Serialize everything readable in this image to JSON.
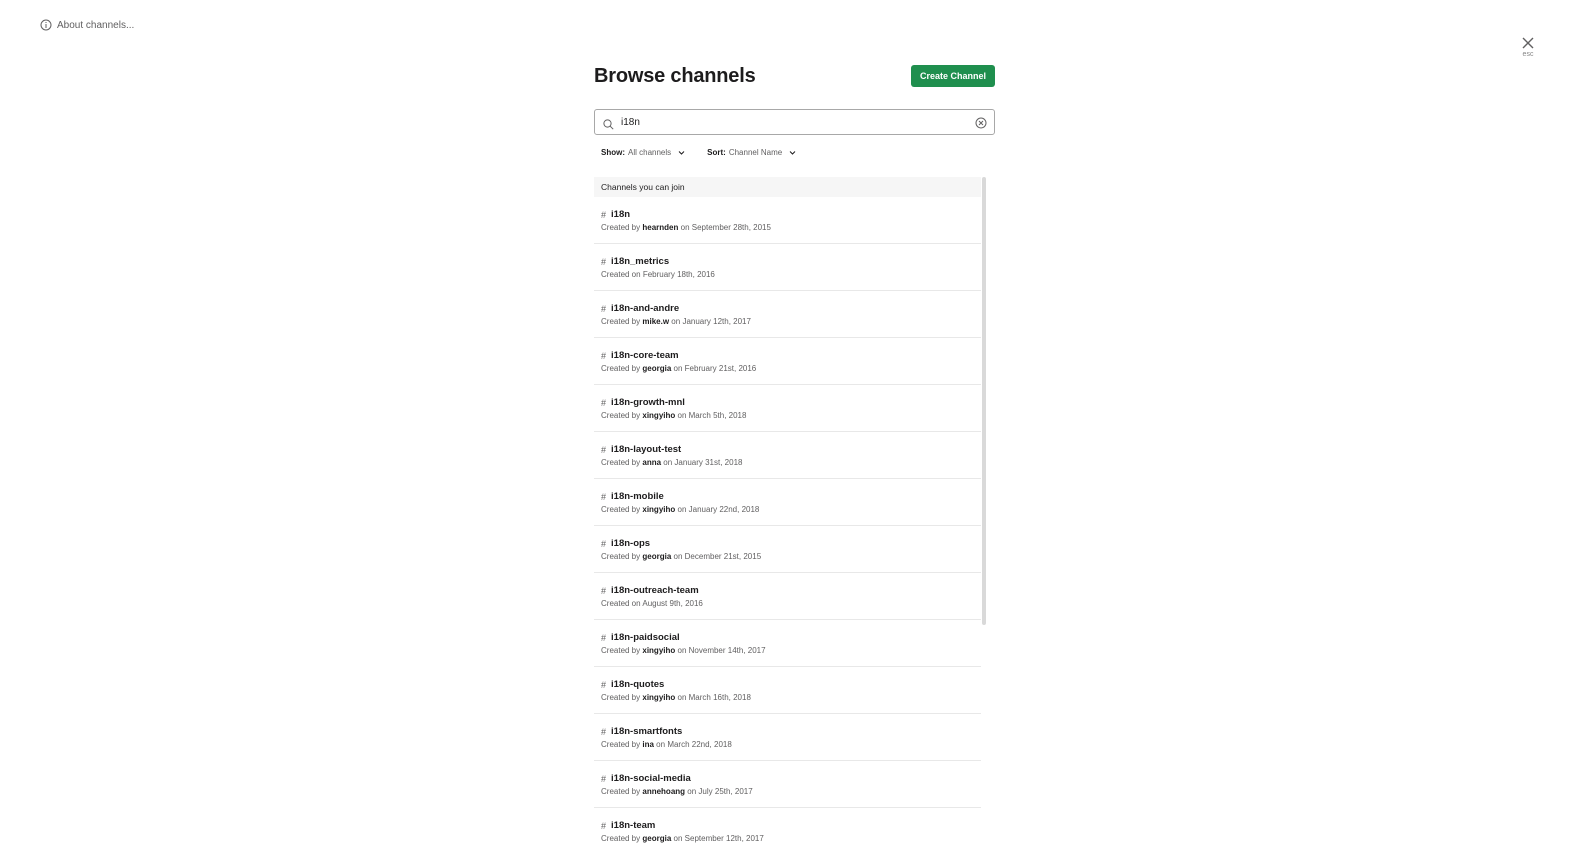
{
  "about": {
    "label": "About channels..."
  },
  "close": {
    "label": "esc"
  },
  "header": {
    "title": "Browse channels",
    "create_label": "Create Channel"
  },
  "search": {
    "value": "i18n"
  },
  "filters": {
    "show_label": "Show:",
    "show_value": "All channels",
    "sort_label": "Sort:",
    "sort_value": "Channel Name"
  },
  "section_title": "Channels you can join",
  "channels": [
    {
      "name": "i18n",
      "creator": "hearnden",
      "date": "September 28th, 2015"
    },
    {
      "name": "i18n_metrics",
      "creator": "",
      "date": "February 18th, 2016"
    },
    {
      "name": "i18n-and-andre",
      "creator": "mike.w",
      "date": "January 12th, 2017"
    },
    {
      "name": "i18n-core-team",
      "creator": "georgia",
      "date": "February 21st, 2016"
    },
    {
      "name": "i18n-growth-mnl",
      "creator": "xingyiho",
      "date": "March 5th, 2018"
    },
    {
      "name": "i18n-layout-test",
      "creator": "anna",
      "date": "January 31st, 2018"
    },
    {
      "name": "i18n-mobile",
      "creator": "xingyiho",
      "date": "January 22nd, 2018"
    },
    {
      "name": "i18n-ops",
      "creator": "georgia",
      "date": "December 21st, 2015"
    },
    {
      "name": "i18n-outreach-team",
      "creator": "",
      "date": "August 9th, 2016"
    },
    {
      "name": "i18n-paidsocial",
      "creator": "xingyiho",
      "date": "November 14th, 2017"
    },
    {
      "name": "i18n-quotes",
      "creator": "xingyiho",
      "date": "March 16th, 2018"
    },
    {
      "name": "i18n-smartfonts",
      "creator": "ina",
      "date": "March 22nd, 2018"
    },
    {
      "name": "i18n-social-media",
      "creator": "annehoang",
      "date": "July 25th, 2017"
    },
    {
      "name": "i18n-team",
      "creator": "georgia",
      "date": "September 12th, 2017"
    }
  ],
  "labels": {
    "created_by": "Created by",
    "created_on": "Created on",
    "on": "on",
    "hash": "#"
  },
  "colors": {
    "accent": "#1f8f4e"
  }
}
